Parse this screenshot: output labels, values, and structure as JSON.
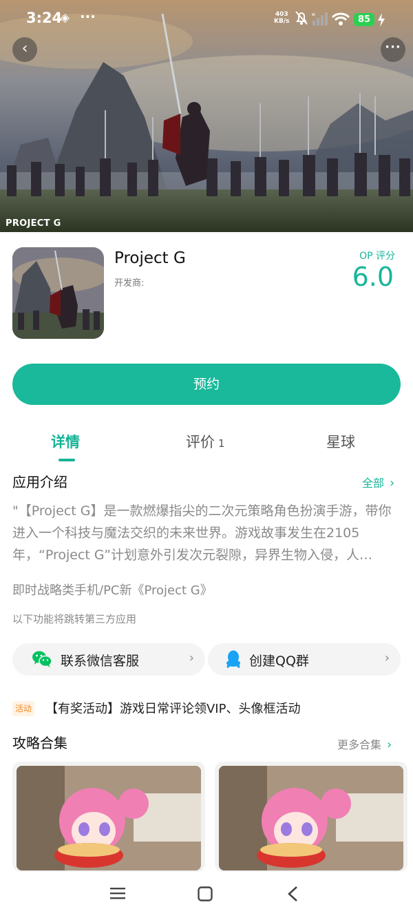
{
  "status_bar": {
    "time": "3:24",
    "net_speed_value": "403",
    "net_speed_unit": "KB/s",
    "battery": "85",
    "more_dots": "···"
  },
  "hero": {
    "caption": "PROJECT G"
  },
  "app": {
    "name": "Project G",
    "developer_label": "开发商:",
    "rating_label": "OP 评分",
    "rating_value": "6.0"
  },
  "actions": {
    "reserve_label": "预约"
  },
  "tabs": {
    "detail": "详情",
    "review": "评价",
    "review_count": "1",
    "planet": "星球"
  },
  "intro": {
    "title": "应用介绍",
    "all_link": "全部",
    "description": "\"【Project G】是一款燃爆指尖的二次元策略角色扮演手游，带你进入一个科技与魔法交织的未来世界。游戏故事发生在2105年，“Project G”计划意外引发次元裂隙，异界生物入侵，人…",
    "tagline": "即时战略类手机/PC新《Project G》",
    "third_party_note": "以下功能将跳转第三方应用"
  },
  "contacts": {
    "wechat_label": "联系微信客服",
    "qq_label": "创建QQ群"
  },
  "activity": {
    "badge": "活动",
    "text": "【有奖活动】游戏日常评论领VIP、头像框活动"
  },
  "guides": {
    "title": "攻略合集",
    "more_link": "更多合集"
  },
  "colors": {
    "accent": "#1ab99b",
    "activity_badge": "#f08a24",
    "battery": "#2dcf52"
  }
}
